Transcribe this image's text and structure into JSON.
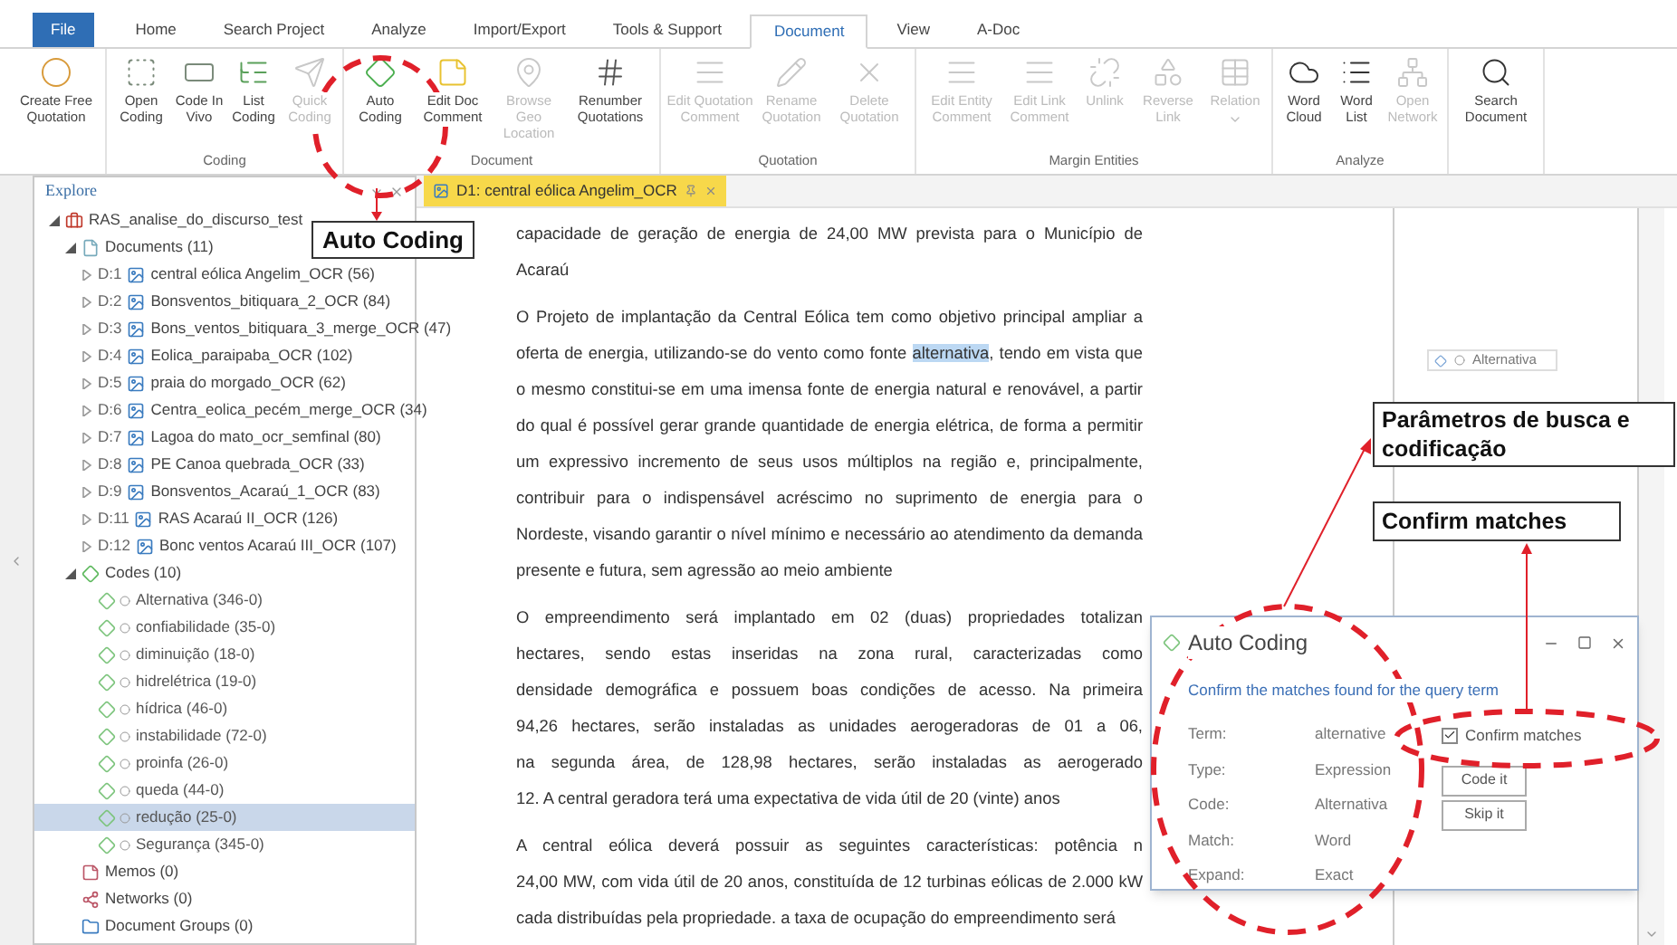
{
  "ribbon_tabs": [
    {
      "label": "File",
      "kind": "file",
      "selected": false
    },
    {
      "label": "Home",
      "kind": "tab",
      "selected": false
    },
    {
      "label": "Search Project",
      "kind": "tab",
      "selected": false
    },
    {
      "label": "Analyze",
      "kind": "tab",
      "selected": false
    },
    {
      "label": "Import/Export",
      "kind": "tab",
      "selected": false
    },
    {
      "label": "Tools & Support",
      "kind": "tab",
      "selected": false
    },
    {
      "label": "Document",
      "kind": "tab",
      "selected": true
    },
    {
      "label": "View",
      "kind": "tab",
      "selected": false
    },
    {
      "label": "A-Doc",
      "kind": "tab",
      "selected": false
    }
  ],
  "ribbon_groups": [
    {
      "buttons": [
        {
          "label": "Create Free Quotation",
          "disabled": false
        }
      ]
    },
    {
      "label": "Coding",
      "buttons": [
        {
          "label": "Open Coding",
          "disabled": false
        },
        {
          "label": "Code In Vivo",
          "disabled": false
        },
        {
          "label": "List Coding",
          "disabled": false
        },
        {
          "label": "Quick Coding",
          "disabled": true
        }
      ]
    },
    {
      "label": "Document",
      "buttons": [
        {
          "label": "Auto Coding",
          "disabled": false
        },
        {
          "label": "Edit Doc Comment",
          "disabled": false
        },
        {
          "label": "Browse Geo Location",
          "disabled": true
        },
        {
          "label": "Renumber Quotations",
          "disabled": false
        }
      ]
    },
    {
      "label": "Quotation",
      "buttons": [
        {
          "label": "Edit Quotation Comment",
          "disabled": true
        },
        {
          "label": "Rename Quotation",
          "disabled": true
        },
        {
          "label": "Delete Quotation",
          "disabled": true
        }
      ]
    },
    {
      "label": "Margin Entities",
      "buttons": [
        {
          "label": "Edit Entity Comment",
          "disabled": true
        },
        {
          "label": "Edit Link Comment",
          "disabled": true
        },
        {
          "label": "Unlink",
          "disabled": true
        },
        {
          "label": "Reverse Link",
          "disabled": true
        },
        {
          "label": "Relation",
          "disabled": true
        }
      ]
    },
    {
      "label": "Analyze",
      "buttons": [
        {
          "label": "Word Cloud",
          "disabled": false
        },
        {
          "label": "Word List",
          "disabled": false
        },
        {
          "label": "Open Network",
          "disabled": true
        }
      ]
    },
    {
      "buttons": [
        {
          "label": "Search Document",
          "disabled": false
        }
      ]
    }
  ],
  "explore_panel": {
    "title": "Explore",
    "tree": [
      {
        "label": "RAS_analise_do_discurso_test",
        "kind": "project",
        "expanded": true,
        "children": [
          {
            "label": "Documents (11)",
            "kind": "documents",
            "expanded": true,
            "children": [
              {
                "number": "D:1",
                "label": "central eólica Angelim_OCR (56)",
                "kind": "document",
                "expanded": false
              },
              {
                "number": "D:2",
                "label": "Bonsventos_bitiquara_2_OCR (84)",
                "kind": "document",
                "expanded": false
              },
              {
                "number": "D:3",
                "label": "Bons_ventos_bitiquara_3_merge_OCR (47)",
                "kind": "document",
                "expanded": false
              },
              {
                "number": "D:4",
                "label": "Eolica_paraipaba_OCR (102)",
                "kind": "document",
                "expanded": false
              },
              {
                "number": "D:5",
                "label": "praia do morgado_OCR (62)",
                "kind": "document",
                "expanded": false
              },
              {
                "number": "D:6",
                "label": "Centra_eolica_pecém_merge_OCR (34)",
                "kind": "document",
                "expanded": false
              },
              {
                "number": "D:7",
                "label": "Lagoa do mato_ocr_semfinal (80)",
                "kind": "document",
                "expanded": false
              },
              {
                "number": "D:8",
                "label": "PE Canoa quebrada_OCR (33)",
                "kind": "document",
                "expanded": false
              },
              {
                "number": "D:9",
                "label": "Bonsventos_Acaraú_1_OCR (83)",
                "kind": "document",
                "expanded": false
              },
              {
                "number": "D:11",
                "label": "RAS Acaraú II_OCR (126)",
                "kind": "document",
                "expanded": false
              },
              {
                "number": "D:12",
                "label": "Bonc ventos Acaraú III_OCR (107)",
                "kind": "document",
                "expanded": false
              }
            ]
          },
          {
            "label": "Codes (10)",
            "kind": "codes",
            "expanded": true,
            "children": [
              {
                "label": "Alternativa (346-0)",
                "kind": "code",
                "selected": false
              },
              {
                "label": "confiabilidade (35-0)",
                "kind": "code",
                "selected": false
              },
              {
                "label": "diminuição (18-0)",
                "kind": "code",
                "selected": false
              },
              {
                "label": "hidrelétrica (19-0)",
                "kind": "code",
                "selected": false
              },
              {
                "label": "hídrica (46-0)",
                "kind": "code",
                "selected": false
              },
              {
                "label": "instabilidade (72-0)",
                "kind": "code",
                "selected": false
              },
              {
                "label": "proinfa (26-0)",
                "kind": "code",
                "selected": false
              },
              {
                "label": "queda (44-0)",
                "kind": "code",
                "selected": false
              },
              {
                "label": "redução (25-0)",
                "kind": "code",
                "selected": true
              },
              {
                "label": "Segurança (345-0)",
                "kind": "code",
                "selected": false
              }
            ]
          },
          {
            "label": "Memos (0)",
            "kind": "memos"
          },
          {
            "label": "Networks (0)",
            "kind": "networks"
          },
          {
            "label": "Document Groups (0)",
            "kind": "groups"
          }
        ]
      }
    ]
  },
  "document_tab": {
    "title": "D1: central eólica Angelim_OCR"
  },
  "document": {
    "paragraphs": [
      {
        "lines": [
          {
            "text": "capacidade de geração de energia de 24,00 MW prevista para o Município de"
          },
          {
            "text": "Acaraú"
          }
        ]
      },
      {
        "lines": [
          {
            "text": "O Projeto de implantação da Central Eólica tem como objetivo principal ampliar a"
          },
          {
            "text": "oferta de energia, utilizando-se do vento como fonte ",
            "highlight": "alternativa",
            "rest": ", tendo em vista que"
          },
          {
            "text": "o mesmo constitui-se em uma imensa fonte de energia natural e renovável, a partir"
          },
          {
            "text": "do qual é possível gerar grande quantidade de energia elétrica, de forma a permitir"
          },
          {
            "text": "um expressivo incremento de seus usos múltiplos na região e, principalmente,"
          },
          {
            "text": "contribuir para o indispensável acréscimo no suprimento de energia para o"
          },
          {
            "text": "Nordeste, visando garantir o nível mínimo e necessário ao atendimento da demanda"
          },
          {
            "text": "presente e futura, sem agressão ao meio ambiente"
          }
        ]
      },
      {
        "lines": [
          {
            "text": "O empreendimento será implantado em 02 (duas) propriedades totalizan"
          },
          {
            "text": "hectares, sendo estas inseridas na zona rural, caracterizadas como"
          },
          {
            "text": "densidade demográfica e possuem boas condições de acesso. Na primeira"
          },
          {
            "text": "94,26 hectares, serão instaladas as unidades aerogeradoras de 01 a 06,"
          },
          {
            "text": "na segunda área, de 128,98 hectares, serão instaladas as aerogerado"
          },
          {
            "text": "12. A central geradora terá uma expectativa de vida útil de 20 (vinte) anos"
          }
        ]
      },
      {
        "lines": [
          {
            "text": "A central eólica deverá possuir as seguintes características: potência n"
          },
          {
            "text": "24,00 MW, com vida útil de 20 anos, constituída de 12 turbinas eólicas de 2.000 kW"
          },
          {
            "text": "cada distribuídas pela propriedade. a taxa de ocupação do empreendimento será"
          }
        ]
      }
    ]
  },
  "margin": {
    "codes": [
      {
        "label": "Alternativa"
      }
    ]
  },
  "dialog": {
    "title": "Auto Coding",
    "prompt": "Confirm the matches found for the query term",
    "fields": [
      {
        "label": "Term:",
        "value": "alternative"
      },
      {
        "label": "Type:",
        "value": "Expression"
      },
      {
        "label": "Code:",
        "value": "Alternativa"
      },
      {
        "label": "Match:",
        "value": "Word"
      },
      {
        "label": "Expand:",
        "value": "Exact"
      }
    ],
    "confirm_matches": {
      "label": "Confirm matches",
      "checked": true
    },
    "buttons": [
      "Code it",
      "Skip it"
    ]
  },
  "annotations": {
    "callouts": [
      {
        "text": "Auto Coding"
      },
      {
        "text": "Parâmetros de busca e codificação"
      },
      {
        "text": "Confirm matches"
      }
    ]
  }
}
